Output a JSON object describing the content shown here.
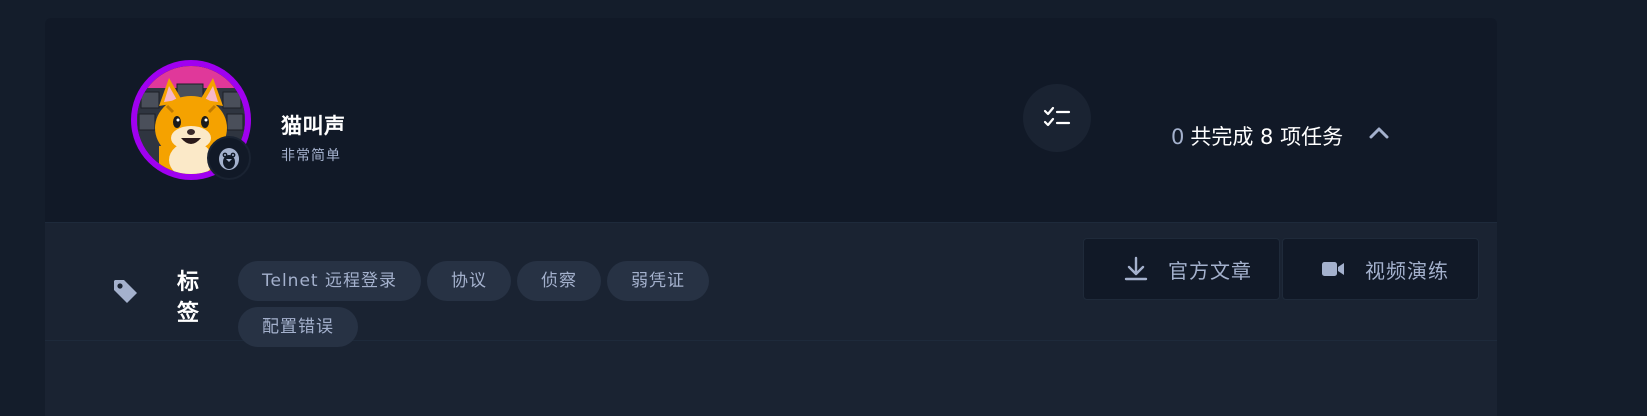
{
  "machine": {
    "name": "猫叫声",
    "difficulty": "非常简单",
    "avatar_icon": "cat-avatar-icon",
    "os_icon": "linux-penguin-icon",
    "ring_color": "#a000f0"
  },
  "progress": {
    "completed": "0",
    "summary": "共完成 8 项任务",
    "toggle_icon": "chevron-up-icon"
  },
  "tags": {
    "label_line1": "标",
    "label_line2": "签",
    "icon": "tag-icon",
    "items": [
      "Telnet 远程登录",
      "协议",
      "侦察",
      "弱凭证",
      "配置错误"
    ]
  },
  "actions": {
    "article": "官方文章",
    "article_icon": "download-icon",
    "video": "视频演练",
    "video_icon": "video-camera-icon"
  },
  "colors": {
    "background": "#141d2b",
    "header": "#111927",
    "body": "#1a2332",
    "tag_bg": "#273244",
    "muted_text": "#a4b1cd"
  }
}
